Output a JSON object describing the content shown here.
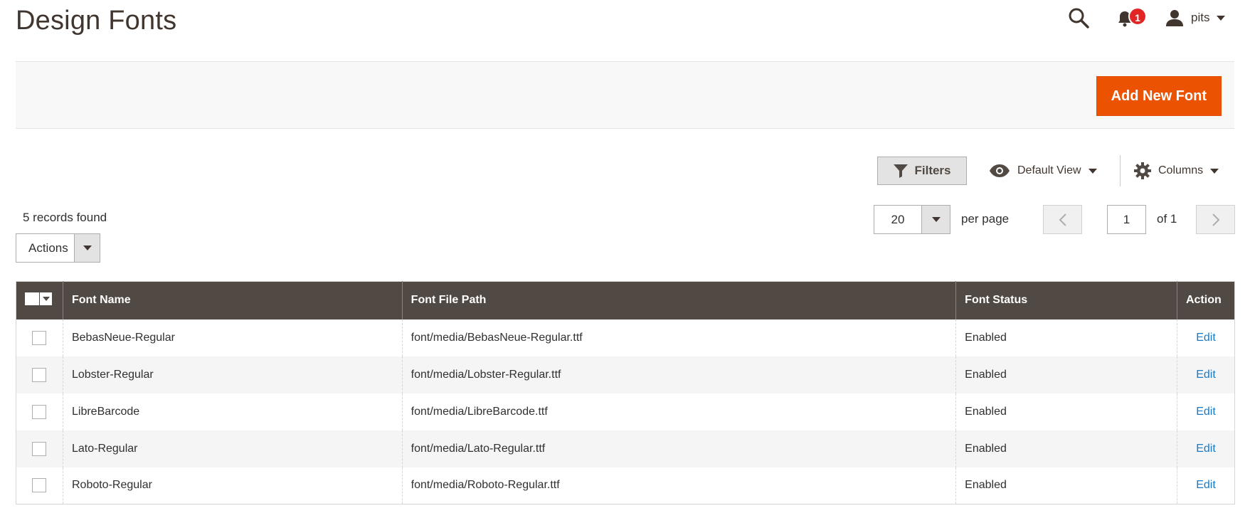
{
  "page": {
    "title": "Design Fonts"
  },
  "header": {
    "notification_count": "1",
    "user_name": "pits",
    "icons": {
      "search": "search-icon",
      "notifications": "bell-icon",
      "user": "user-icon"
    }
  },
  "action_bar": {
    "add_button_label": "Add New Font"
  },
  "toolbar": {
    "filters_label": "Filters",
    "view_label": "Default View",
    "columns_label": "Columns"
  },
  "grid_meta": {
    "records_found": "5 records found",
    "actions_label": "Actions",
    "per_page_value": "20",
    "per_page_label": "per page",
    "current_page": "1",
    "total_pages_label": "of 1"
  },
  "table": {
    "columns": [
      "Font Name",
      "Font File Path",
      "Font Status",
      "Action"
    ],
    "rows": [
      {
        "name": "BebasNeue-Regular",
        "path": "font/media/BebasNeue-Regular.ttf",
        "status": "Enabled",
        "action": "Edit"
      },
      {
        "name": "Lobster-Regular",
        "path": "font/media/Lobster-Regular.ttf",
        "status": "Enabled",
        "action": "Edit"
      },
      {
        "name": "LibreBarcode",
        "path": "font/media/LibreBarcode.ttf",
        "status": "Enabled",
        "action": "Edit"
      },
      {
        "name": "Lato-Regular",
        "path": "font/media/Lato-Regular.ttf",
        "status": "Enabled",
        "action": "Edit"
      },
      {
        "name": "Roboto-Regular",
        "path": "font/media/Roboto-Regular.ttf",
        "status": "Enabled",
        "action": "Edit"
      }
    ]
  },
  "colors": {
    "accent": "#eb5202",
    "table_header": "#514943",
    "link": "#1979c3",
    "badge": "#e22626"
  }
}
